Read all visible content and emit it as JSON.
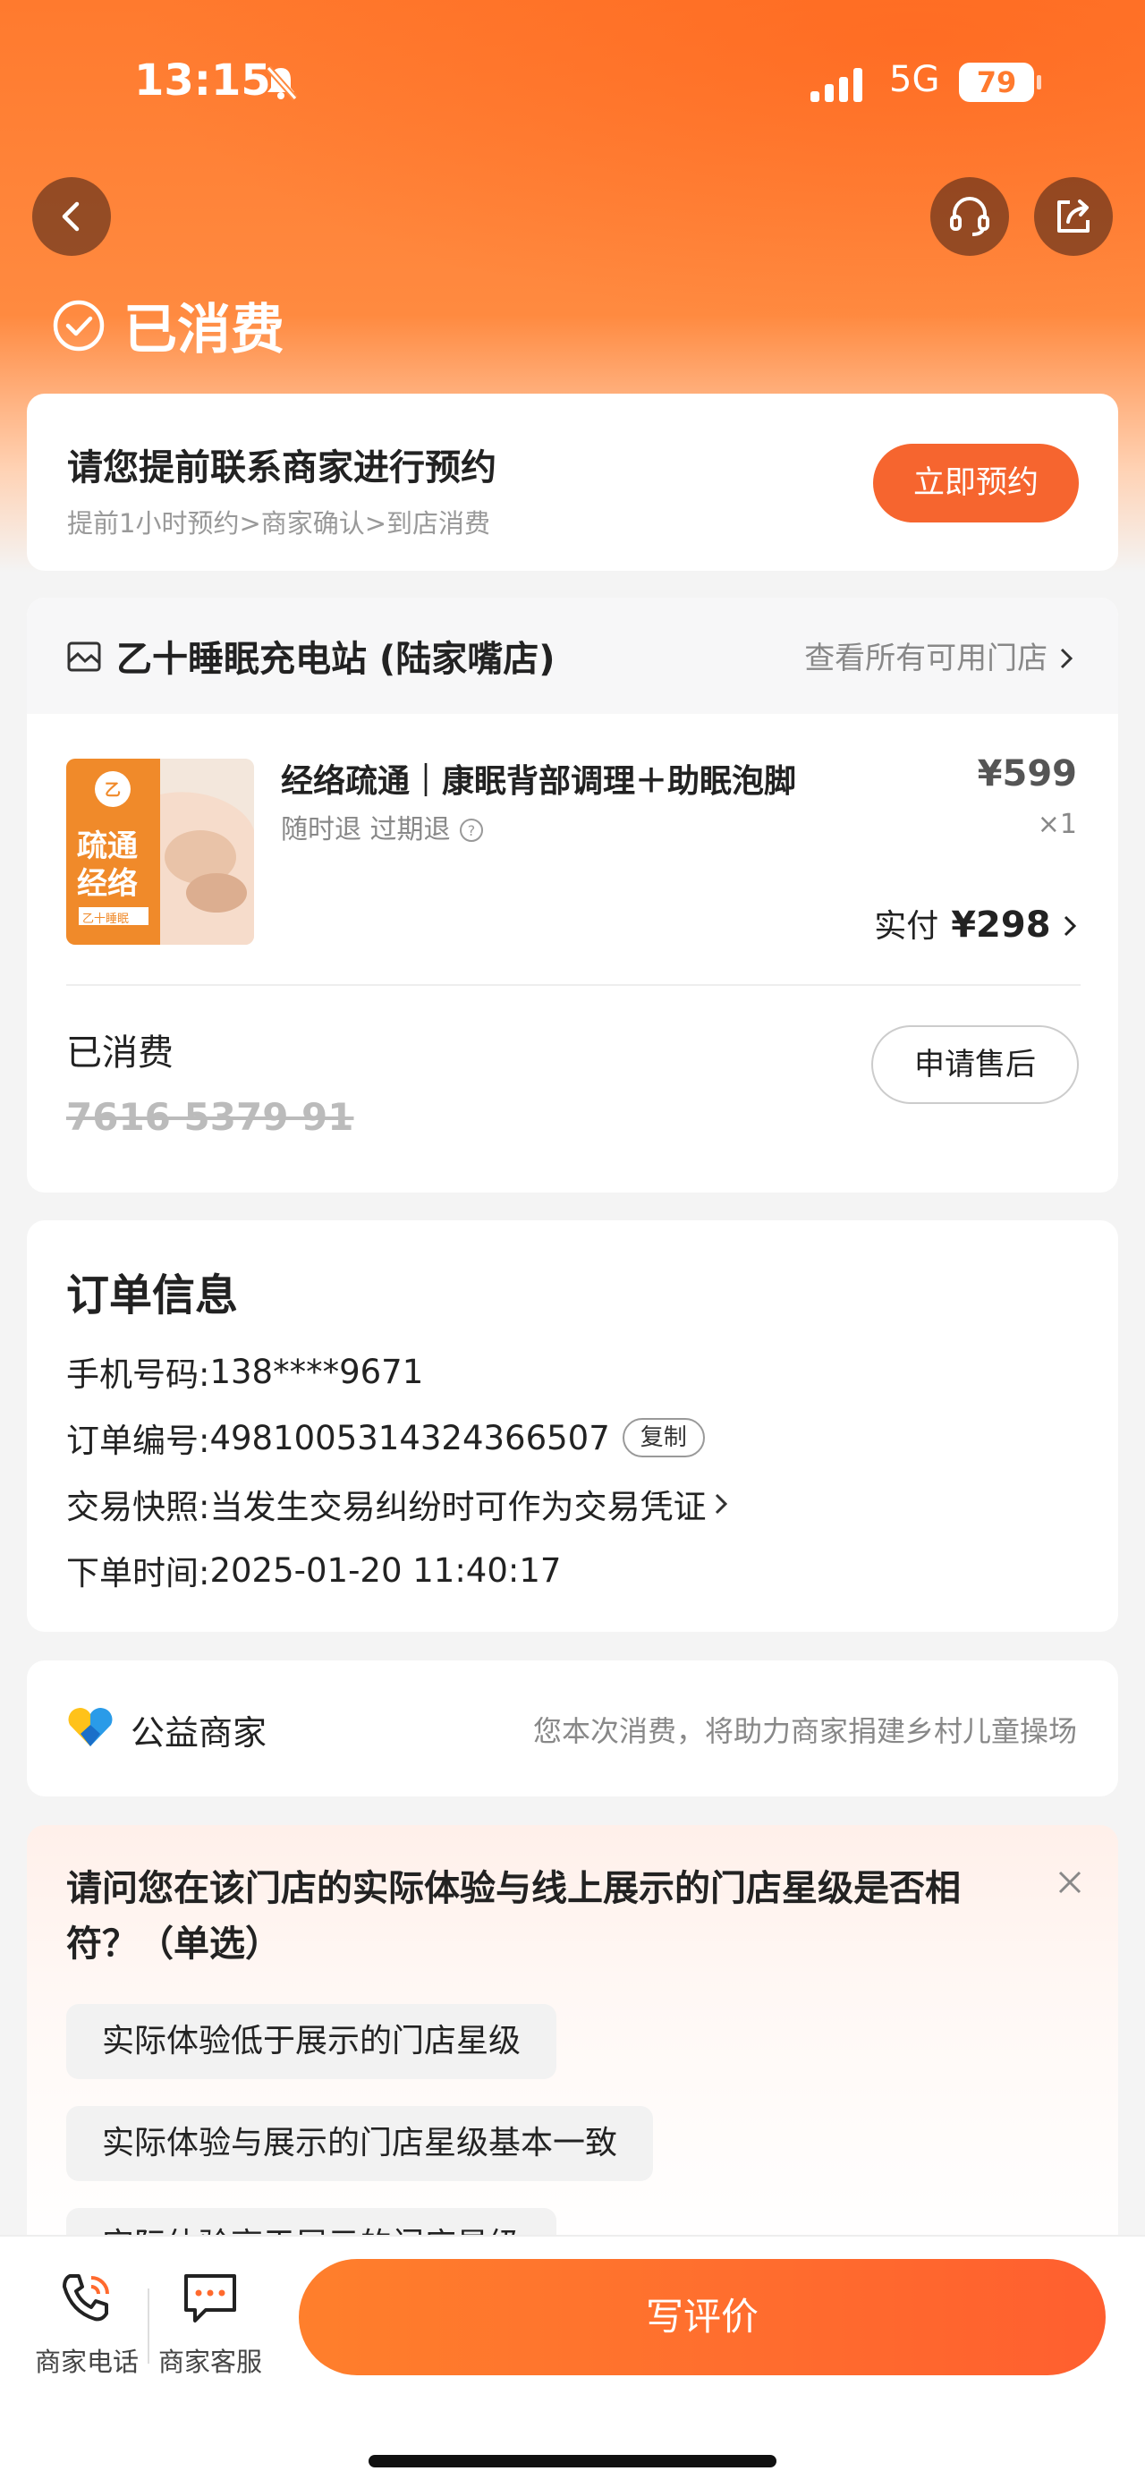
{
  "status_bar": {
    "time": "13:15",
    "network": "5G",
    "battery": "79"
  },
  "header": {
    "status_title": "已消费"
  },
  "appointment": {
    "title": "请您提前联系商家进行预约",
    "subtitle": "提前1小时预约>商家确认>到店消费",
    "button": "立即预约"
  },
  "order": {
    "shop_name": "乙十睡眠充电站 (陆家嘴店)",
    "shop_link": "查看所有可用门店",
    "product": {
      "name": "经络疏通｜康眠背部调理＋助眠泡脚",
      "tags": "随时退  过期退",
      "price": "¥599",
      "quantity": "×1",
      "paid_label": "实付",
      "paid_amount": "¥298",
      "image_text_1": "疏通",
      "image_text_2": "经络",
      "image_logo": "乙十睡眠"
    },
    "consumed_label": "已消费",
    "code": "7616 5379 91",
    "after_sale_button": "申请售后"
  },
  "order_info": {
    "title": "订单信息",
    "phone_label": "手机号码:",
    "phone_value": "138****9671",
    "order_no_label": "订单编号:",
    "order_no_value": "4981005314324366507",
    "copy_button": "复制",
    "snapshot_label": "交易快照:",
    "snapshot_value": "当发生交易纠纷时可作为交易凭证",
    "time_label": "下单时间:",
    "time_value": "2025-01-20 11:40:17"
  },
  "charity": {
    "name": "公益商家",
    "description": "您本次消费，将助力商家捐建乡村儿童操场"
  },
  "survey": {
    "question": "请问您在该门店的实际体验与线上展示的门店星级是否相符？（单选）",
    "options": [
      "实际体验低于展示的门店星级",
      "实际体验与展示的门店星级基本一致",
      "实际体验高于展示的门店星级"
    ]
  },
  "bottom_bar": {
    "phone_label": "商家电话",
    "service_label": "商家客服",
    "review_button": "写评价"
  },
  "colors": {
    "accent": "#f6652f",
    "header_gradient_top": "#ff7a2e"
  }
}
